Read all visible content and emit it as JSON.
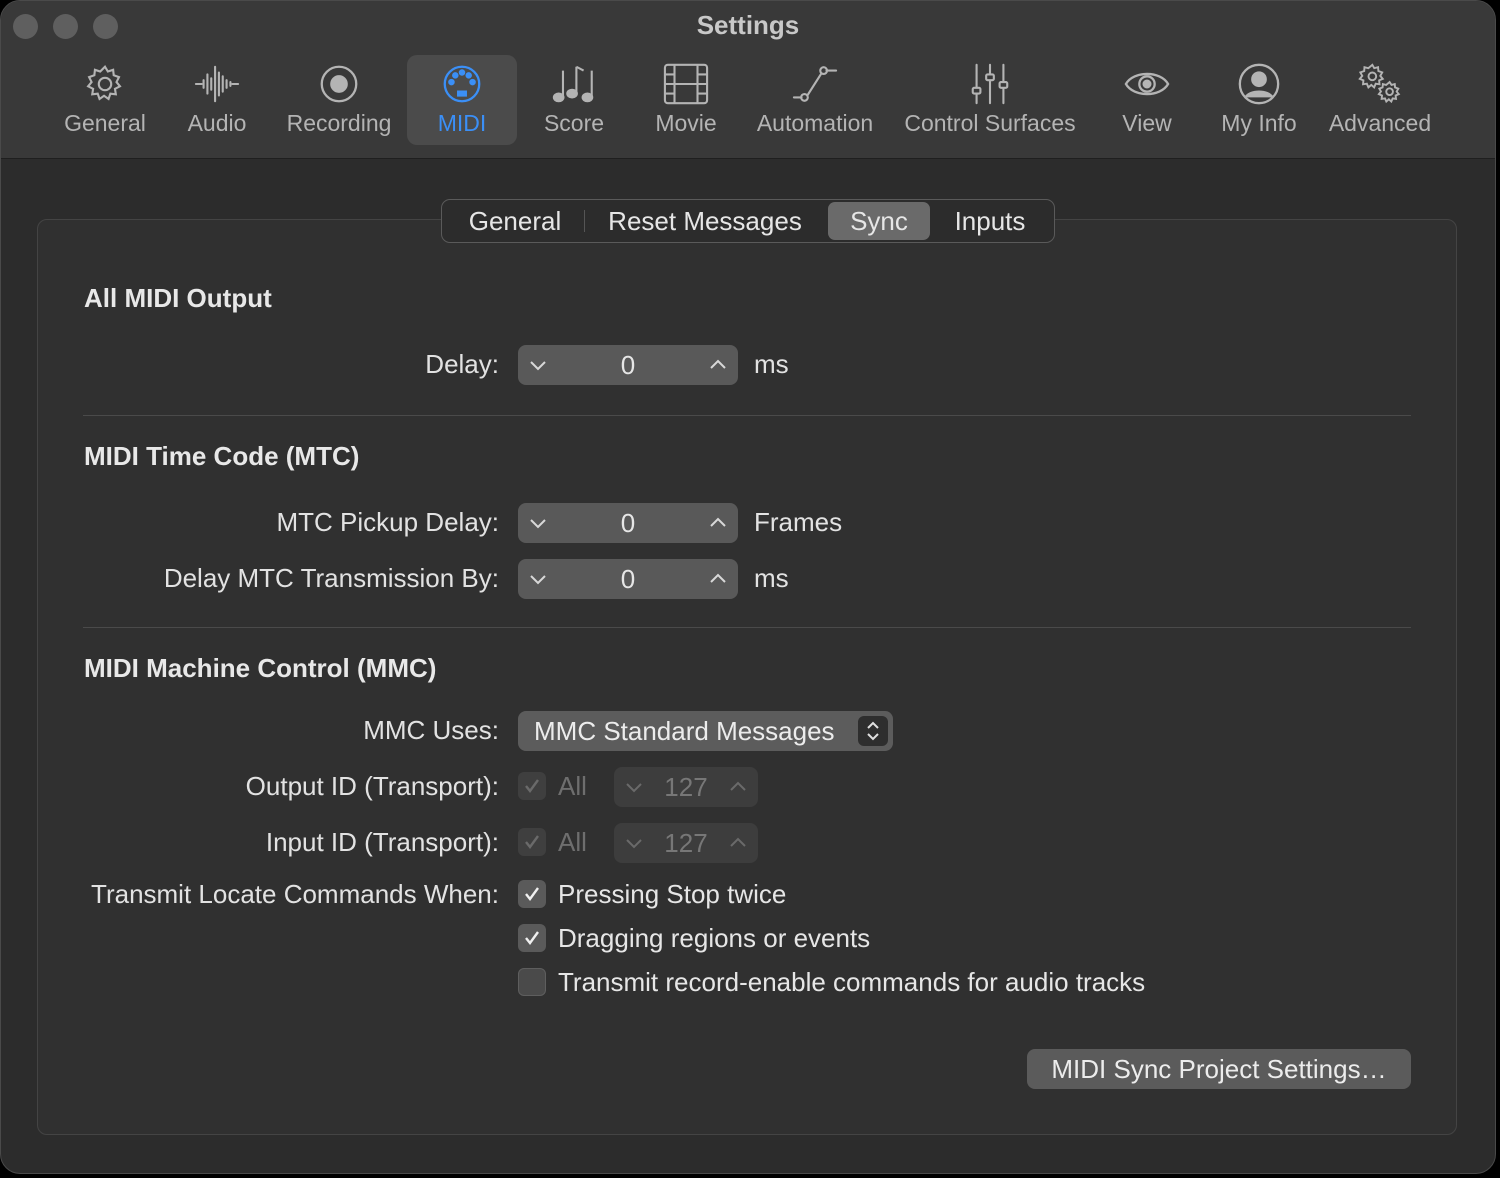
{
  "window": {
    "title": "Settings"
  },
  "toolbar": {
    "items": [
      {
        "label": "General",
        "icon": "gear-icon"
      },
      {
        "label": "Audio",
        "icon": "waveform-icon"
      },
      {
        "label": "Recording",
        "icon": "record-icon"
      },
      {
        "label": "MIDI",
        "icon": "midi-port-icon",
        "active": true
      },
      {
        "label": "Score",
        "icon": "music-notes-icon"
      },
      {
        "label": "Movie",
        "icon": "film-icon"
      },
      {
        "label": "Automation",
        "icon": "automation-curve-icon"
      },
      {
        "label": "Control Surfaces",
        "icon": "sliders-icon"
      },
      {
        "label": "View",
        "icon": "eye-icon"
      },
      {
        "label": "My Info",
        "icon": "person-icon"
      },
      {
        "label": "Advanced",
        "icon": "gears-icon"
      }
    ],
    "accent_color": "#3b8ff6"
  },
  "tabs": {
    "items": [
      {
        "label": "General"
      },
      {
        "label": "Reset Messages"
      },
      {
        "label": "Sync",
        "active": true
      },
      {
        "label": "Inputs"
      }
    ]
  },
  "all_midi_output": {
    "heading": "All MIDI Output",
    "delay": {
      "label": "Delay:",
      "value": "0",
      "unit": "ms"
    }
  },
  "mtc": {
    "heading": "MIDI Time Code (MTC)",
    "pickup_delay": {
      "label": "MTC Pickup Delay:",
      "value": "0",
      "unit": "Frames"
    },
    "transmission_delay": {
      "label": "Delay MTC Transmission By:",
      "value": "0",
      "unit": "ms"
    }
  },
  "mmc": {
    "heading": "MIDI Machine Control (MMC)",
    "uses": {
      "label": "MMC Uses:",
      "value": "MMC Standard Messages"
    },
    "output_id": {
      "label": "Output ID (Transport):",
      "all_label": "All",
      "all_checked": true,
      "value": "127"
    },
    "input_id": {
      "label": "Input ID (Transport):",
      "all_label": "All",
      "all_checked": true,
      "value": "127"
    },
    "locate": {
      "label": "Transmit Locate Commands When:",
      "options": [
        {
          "label": "Pressing Stop twice",
          "checked": true
        },
        {
          "label": "Dragging regions or events",
          "checked": true
        },
        {
          "label": "Transmit record-enable commands for audio tracks",
          "checked": false
        }
      ]
    }
  },
  "footer": {
    "button_label": "MIDI Sync Project Settings…"
  }
}
